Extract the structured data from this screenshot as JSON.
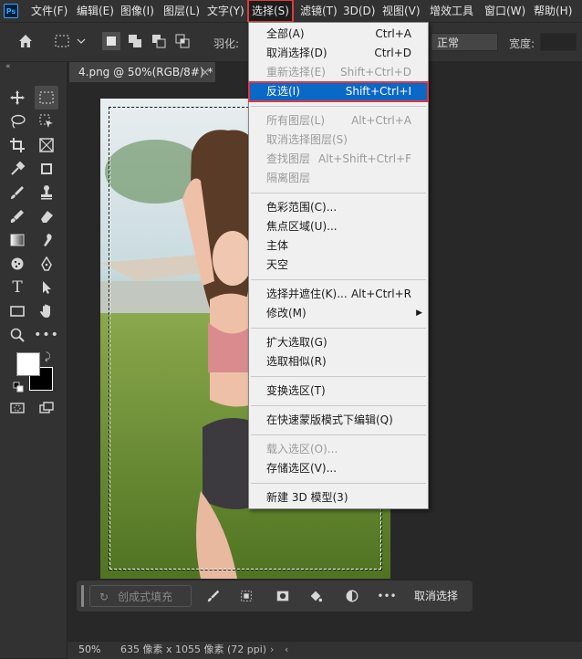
{
  "app": {
    "logo": "Ps"
  },
  "menubar": [
    {
      "label": "文件(F)"
    },
    {
      "label": "编辑(E)"
    },
    {
      "label": "图像(I)"
    },
    {
      "label": "图层(L)"
    },
    {
      "label": "文字(Y)"
    },
    {
      "label": "选择(S)"
    },
    {
      "label": "滤镜(T)"
    },
    {
      "label": "3D(D)"
    },
    {
      "label": "视图(V)"
    },
    {
      "label": "增效工具"
    },
    {
      "label": "窗口(W)"
    },
    {
      "label": "帮助(H)"
    }
  ],
  "options": {
    "feather_label": "羽化:",
    "mode_value": "正常",
    "width_label": "宽度:"
  },
  "tab": {
    "title": "4.png @ 50%(RGB/8#) *",
    "close": "×"
  },
  "select_menu": {
    "items": [
      {
        "label": "全部(A)",
        "shortcut": "Ctrl+A"
      },
      {
        "label": "取消选择(D)",
        "shortcut": "Ctrl+D"
      },
      {
        "label": "重新选择(E)",
        "shortcut": "Shift+Ctrl+D"
      },
      {
        "label": "反选(I)",
        "shortcut": "Shift+Ctrl+I"
      },
      {
        "label": "所有图层(L)",
        "shortcut": "Alt+Ctrl+A"
      },
      {
        "label": "取消选择图层(S)",
        "shortcut": ""
      },
      {
        "label": "查找图层",
        "shortcut": "Alt+Shift+Ctrl+F"
      },
      {
        "label": "隔离图层",
        "shortcut": ""
      },
      {
        "label": "色彩范围(C)...",
        "shortcut": ""
      },
      {
        "label": "焦点区域(U)...",
        "shortcut": ""
      },
      {
        "label": "主体",
        "shortcut": ""
      },
      {
        "label": "天空",
        "shortcut": ""
      },
      {
        "label": "选择并遮住(K)...",
        "shortcut": "Alt+Ctrl+R"
      },
      {
        "label": "修改(M)",
        "shortcut": ""
      },
      {
        "label": "扩大选取(G)",
        "shortcut": ""
      },
      {
        "label": "选取相似(R)",
        "shortcut": ""
      },
      {
        "label": "变换选区(T)",
        "shortcut": ""
      },
      {
        "label": "在快速蒙版模式下编辑(Q)",
        "shortcut": ""
      },
      {
        "label": "载入选区(O)...",
        "shortcut": ""
      },
      {
        "label": "存储选区(V)...",
        "shortcut": ""
      },
      {
        "label": "新建 3D 模型(3)",
        "shortcut": ""
      }
    ]
  },
  "taskbar": {
    "fill_placeholder": "创成式填充",
    "deselect": "取消选择"
  },
  "status": {
    "zoom": "50%",
    "doc_info": "635 像素 x 1055 像素 (72 ppi)"
  },
  "colors": {
    "highlight": "#0a68c6",
    "annotation_red": "#e0393e"
  }
}
